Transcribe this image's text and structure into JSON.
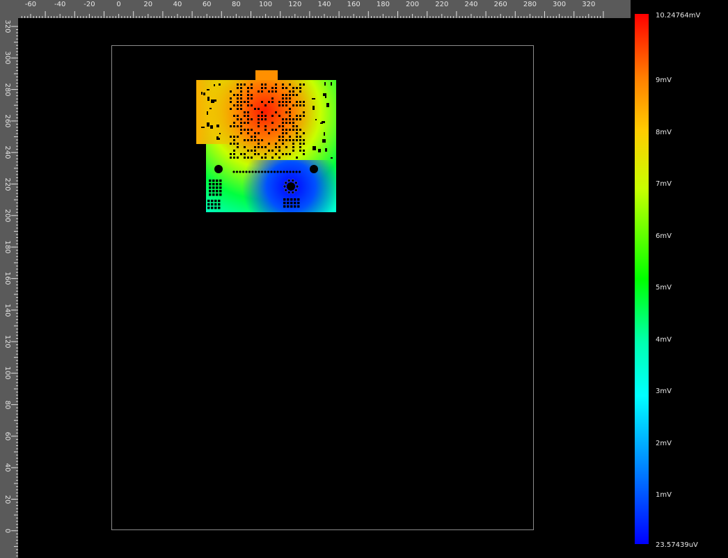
{
  "ruler_x": {
    "labels": [
      "-60",
      "-40",
      "-20",
      "0",
      "20",
      "40",
      "60",
      "80",
      "100",
      "120",
      "140",
      "160",
      "180",
      "200",
      "220",
      "240",
      "260",
      "280",
      "300",
      "320"
    ]
  },
  "ruler_y": {
    "labels": [
      "320",
      "300",
      "280",
      "260",
      "240",
      "220",
      "200",
      "180",
      "160",
      "140",
      "120",
      "100",
      "80",
      "60",
      "40",
      "20",
      "0"
    ]
  },
  "colorbar": {
    "max_label": "10.24764mV",
    "min_label": "23.57439uV",
    "ticks": [
      "9mV",
      "8mV",
      "7mV",
      "6mV",
      "5mV",
      "4mV",
      "3mV",
      "2mV",
      "1mV"
    ],
    "colors": {
      "high": "#ff0000",
      "low": "#0000ff"
    }
  },
  "view": {
    "background": "#000000",
    "ruler_color": "#5a5a5a",
    "outline_color": "#8c8c8c"
  }
}
